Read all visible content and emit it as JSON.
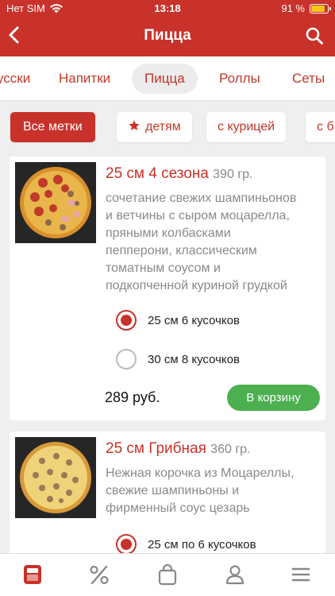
{
  "status": {
    "carrier": "Нет SIM",
    "time": "13:18",
    "battery": "91 %",
    "battery_level": 0.91
  },
  "header": {
    "title": "Пицца"
  },
  "categories": [
    "усски",
    "Напитки",
    "Пицца",
    "Роллы",
    "Сеты"
  ],
  "chips": [
    "Все метки",
    "детям",
    "с курицей",
    "с б"
  ],
  "products": [
    {
      "name": "25 см 4 сезона",
      "weight": "390 гр.",
      "description": [
        "сочетание свежих шампиньонов",
        "и ветчины с сыром моцарелла,",
        "пряными колбасками",
        "пепперони, классическим",
        "томатным соусом и",
        "подкопченной куриной грудкой"
      ],
      "options": [
        "25 см 6 кусочков",
        "30 см 8 кусочков"
      ],
      "selected": 0,
      "price": "289 руб.",
      "cart_label": "В корзину"
    },
    {
      "name": "25 см  Грибная",
      "weight": "360 гр.",
      "description": [
        "Нежная корочка из Моцареллы,",
        "свежие шампиньоны и",
        "фирменный соус цезарь"
      ],
      "options": [
        "25 см по 6 кусочков"
      ],
      "selected": 0
    }
  ],
  "colors": {
    "brand": "#c8322a",
    "cart": "#4caf50",
    "muted": "#8a8a8a"
  },
  "icons": {
    "status": [
      "wifi-icon",
      "battery-icon"
    ],
    "header": [
      "back-chevron-icon",
      "search-icon"
    ],
    "chips": [
      "star-icon"
    ],
    "nav": [
      "menu-card-icon",
      "percent-icon",
      "bag-icon",
      "user-icon",
      "hamburger-icon"
    ]
  }
}
